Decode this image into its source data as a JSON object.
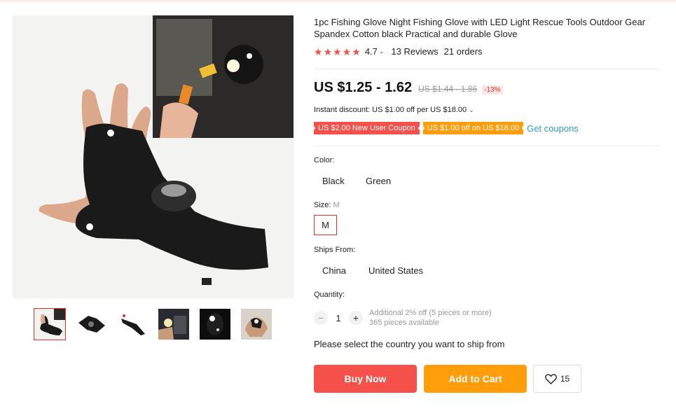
{
  "product": {
    "title": "1pc Fishing Glove Night Fishing Glove with LED Light Rescue Tools Outdoor Gear Spandex Cotton black Practical and durable Glove",
    "rating": "4.7",
    "reviews": "13 Reviews",
    "orders": "21 orders",
    "stars": 4.7
  },
  "price": {
    "current": "US $1.25 - 1.62",
    "original": "US $1.44 - 1.86",
    "discount": "-13%"
  },
  "instant_discount": "Instant discount: US $1.00 off per US $18.00",
  "coupons": {
    "new_user": "US $2.00 New User Coupon",
    "store": "US $1.00 off on US $18.00",
    "get_label": "Get coupons"
  },
  "color": {
    "label": "Color:",
    "options": [
      "Black",
      "Green"
    ]
  },
  "size": {
    "label": "Size:",
    "selected": "M",
    "options": [
      "M"
    ]
  },
  "ships_from": {
    "label": "Ships From:",
    "options": [
      "China",
      "United States"
    ]
  },
  "quantity": {
    "label": "Quantity:",
    "minus": "−",
    "plus": "+",
    "value": "1",
    "note_discount": "Additional 2% off (5 pieces or more)",
    "note_available": "365 pieces available"
  },
  "ship_message": "Please select the country you want to ship from",
  "actions": {
    "buy_now": "Buy Now",
    "add_to_cart": "Add to Cart",
    "wishlist_count": "15"
  },
  "icons": {
    "star": "star-icon",
    "chevron": "chevron-down-icon",
    "heart": "heart-icon"
  },
  "colors": {
    "accent_red": "#f5514a",
    "accent_orange": "#ff9d0a",
    "link_blue": "#2e9cc3"
  }
}
